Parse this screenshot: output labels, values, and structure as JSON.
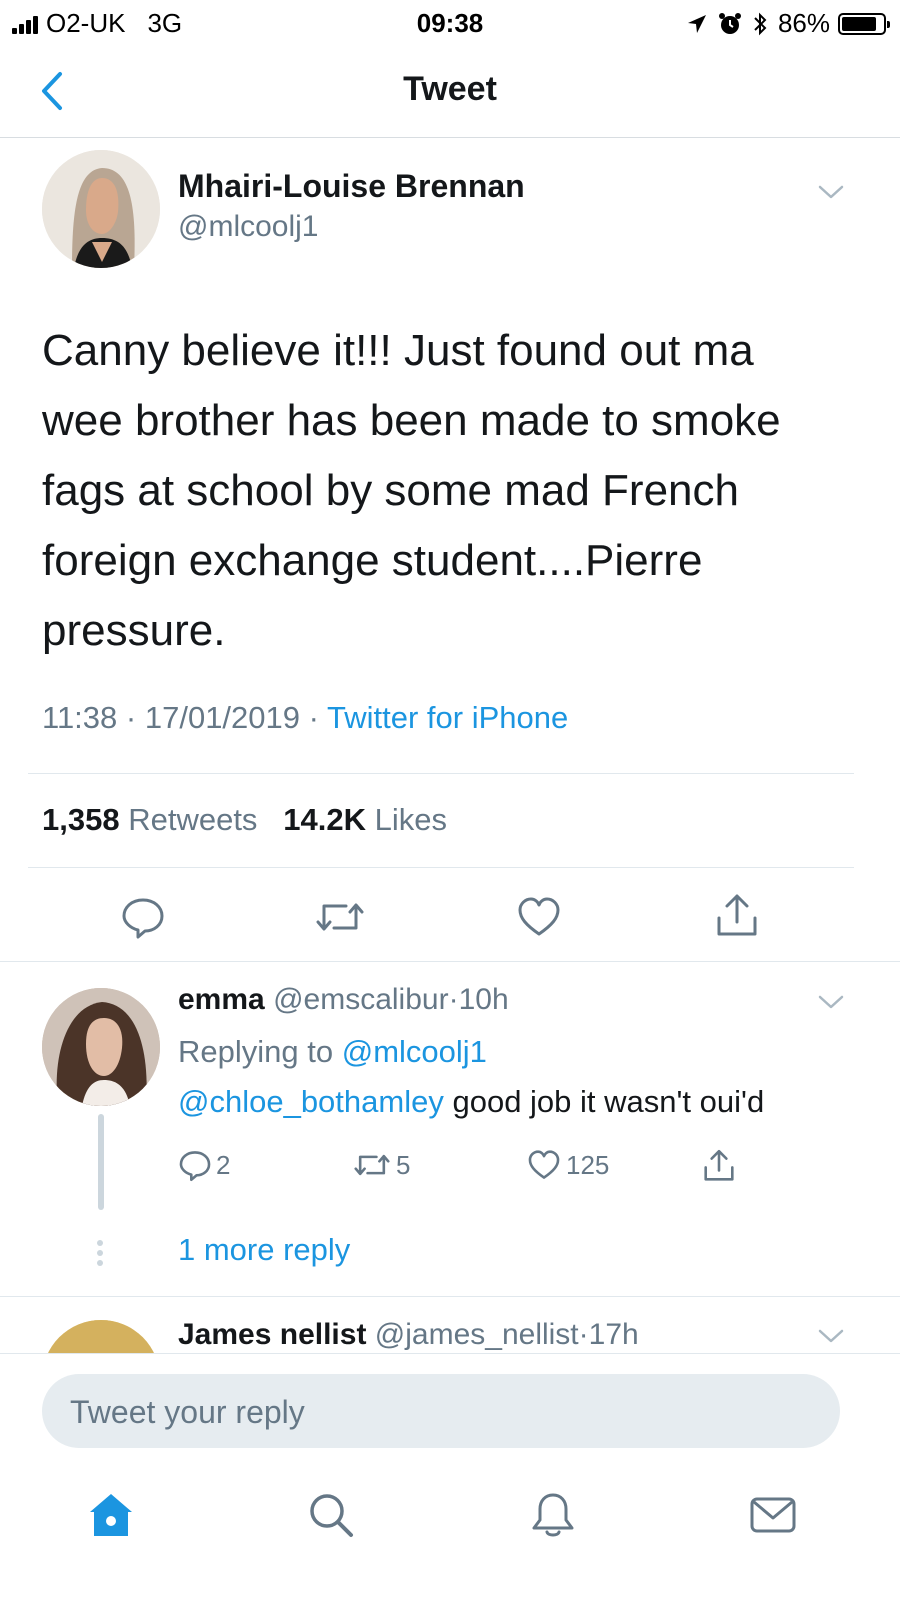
{
  "status_bar": {
    "carrier": "O2-UK",
    "network": "3G",
    "time": "09:38",
    "battery": "86%",
    "battery_level": 0.86
  },
  "nav": {
    "title": "Tweet",
    "back_icon": "chevron-left-icon"
  },
  "tweet": {
    "author_name": "Mhairi-Louise Brennan",
    "author_handle": "@mlcoolj1",
    "text": "Canny believe it!!! Just found out ma wee brother has been made to smoke fags at school by some mad French foreign exchange student....Pierre pressure.",
    "time": "11:38",
    "date": "17/01/2019",
    "separator": "·",
    "source": "Twitter for iPhone",
    "retweets_count": "1,358",
    "retweets_label": "Retweets",
    "likes_count": "14.2K",
    "likes_label": "Likes",
    "actions": [
      "reply-icon",
      "retweet-icon",
      "like-icon",
      "share-icon"
    ]
  },
  "reply": {
    "author_name": "emma",
    "author_handle": "@emscalibur",
    "separator": "·",
    "age": "10h",
    "replying_prefix": "Replying to",
    "replying_to": "@mlcoolj1",
    "mention": "@chloe_bothamley",
    "text": " good job it wasn't oui'd",
    "reply_count": "2",
    "retweet_count": "5",
    "like_count": "125",
    "more_replies": "1 more reply"
  },
  "next_reply": {
    "author_name": "James nellist",
    "author_handle": "@james_nellist",
    "separator": "·",
    "age": "17h"
  },
  "compose": {
    "placeholder": "Tweet your reply"
  },
  "tabbar": {
    "tabs": [
      "home-icon",
      "search-icon",
      "notifications-icon",
      "messages-icon"
    ],
    "active": "home-icon"
  },
  "colors": {
    "accent": "#1b95e0",
    "secondary_text": "#657786",
    "primary_text": "#14171a",
    "divider": "#e1e8ed"
  }
}
